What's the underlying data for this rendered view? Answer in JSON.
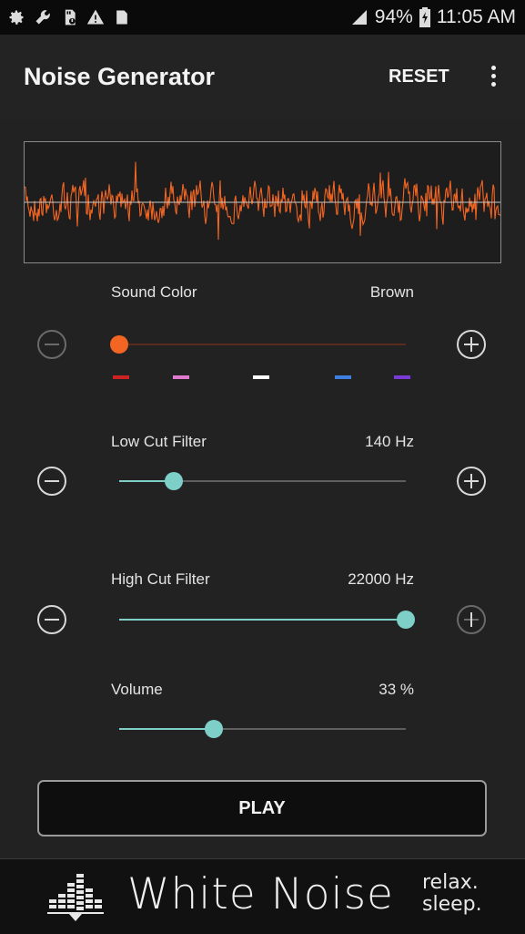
{
  "status_bar": {
    "battery": "94%",
    "time": "11:05 AM",
    "left_icons": [
      "settings-icon",
      "wrench-icon",
      "sd-card-icon",
      "warning-icon",
      "clipboard-icon"
    ]
  },
  "app_bar": {
    "title": "Noise Generator",
    "reset_label": "RESET"
  },
  "controls": {
    "sound_color": {
      "label": "Sound Color",
      "value": "Brown",
      "position": 0.0,
      "accent": "#f26522",
      "color_marks": [
        "#cc2222",
        "#e07ad0",
        "#ffffff",
        "#3f7fe0",
        "#7a3ad8"
      ]
    },
    "low_cut": {
      "label": "Low Cut Filter",
      "value": "140 Hz",
      "position": 0.19
    },
    "high_cut": {
      "label": "High Cut Filter",
      "value": "22000 Hz",
      "position": 1.0
    },
    "volume": {
      "label": "Volume",
      "value": "33 %",
      "position": 0.33
    },
    "slider_accent": "#7ecfc8"
  },
  "play_label": "PLAY",
  "footer": {
    "brand": "White Noise",
    "tagline_1": "relax.",
    "tagline_2": "sleep."
  }
}
